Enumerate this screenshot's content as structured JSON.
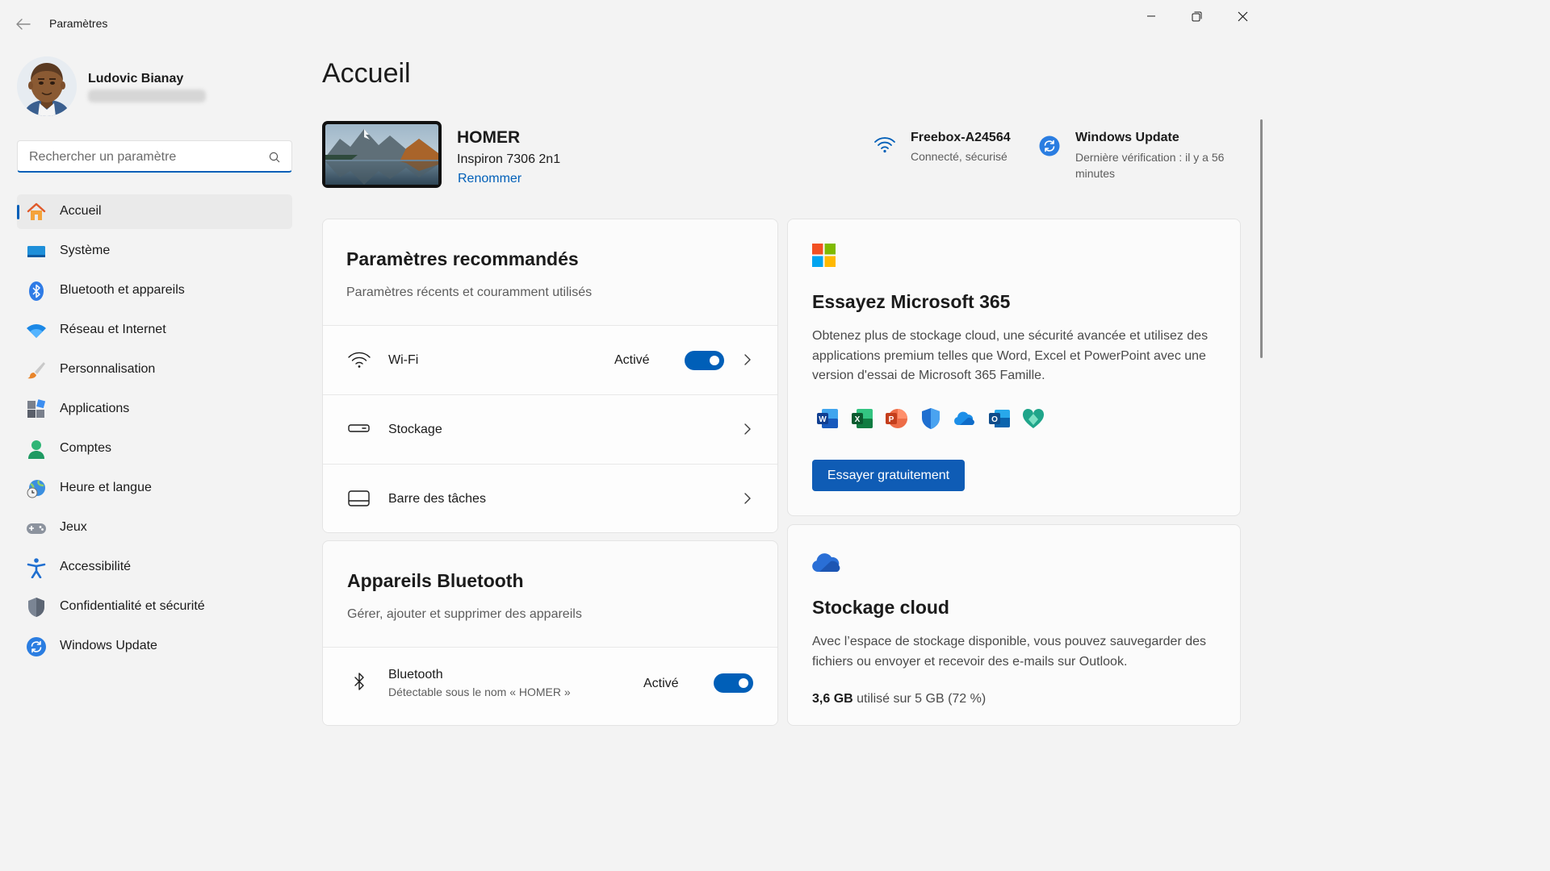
{
  "titlebar": {
    "title": "Paramètres"
  },
  "profile": {
    "name": "Ludovic Bianay"
  },
  "search": {
    "placeholder": "Rechercher un paramètre"
  },
  "sidebar": {
    "items": [
      {
        "label": "Accueil",
        "icon": "home-icon"
      },
      {
        "label": "Système",
        "icon": "system-icon"
      },
      {
        "label": "Bluetooth et appareils",
        "icon": "bluetooth-icon"
      },
      {
        "label": "Réseau et Internet",
        "icon": "network-icon"
      },
      {
        "label": "Personnalisation",
        "icon": "brush-icon"
      },
      {
        "label": "Applications",
        "icon": "apps-icon"
      },
      {
        "label": "Comptes",
        "icon": "accounts-icon"
      },
      {
        "label": "Heure et langue",
        "icon": "time-language-icon"
      },
      {
        "label": "Jeux",
        "icon": "gamepad-icon"
      },
      {
        "label": "Accessibilité",
        "icon": "accessibility-icon"
      },
      {
        "label": "Confidentialité et sécurité",
        "icon": "shield-icon"
      },
      {
        "label": "Windows Update",
        "icon": "update-icon"
      }
    ],
    "active_index": 0
  },
  "main": {
    "title": "Accueil",
    "device": {
      "name": "HOMER",
      "model": "Inspiron 7306 2n1",
      "rename_label": "Renommer"
    },
    "wifi": {
      "name": "Freebox-A24564",
      "status": "Connecté, sécurisé"
    },
    "update": {
      "title": "Windows Update",
      "status": "Dernière vérification : il y a 56 minutes"
    }
  },
  "recommended": {
    "title": "Paramètres recommandés",
    "subtitle": "Paramètres récents et couramment utilisés",
    "rows": [
      {
        "label": "Wi-Fi",
        "value": "Activé",
        "toggle_on": true,
        "icon": "wifi-icon"
      },
      {
        "label": "Stockage",
        "icon": "storage-icon"
      },
      {
        "label": "Barre des tâches",
        "icon": "taskbar-icon"
      }
    ]
  },
  "bluetooth_card": {
    "title": "Appareils Bluetooth",
    "subtitle": "Gérer, ajouter et supprimer des appareils",
    "row": {
      "label": "Bluetooth",
      "detail": "Détectable sous le nom « HOMER »",
      "value": "Activé",
      "toggle_on": true
    }
  },
  "m365": {
    "title": "Essayez Microsoft 365",
    "description": "Obtenez plus de stockage cloud, une sécurité avancée et utilisez des applications premium telles que Word, Excel et PowerPoint avec une version d'essai de Microsoft 365 Famille.",
    "button": "Essayer gratuitement",
    "apps": [
      "word-icon",
      "excel-icon",
      "powerpoint-icon",
      "defender-icon",
      "onedrive-icon",
      "outlook-icon",
      "family-safety-icon"
    ]
  },
  "cloud": {
    "title": "Stockage cloud",
    "description": "Avec l’espace de stockage disponible, vous pouvez sauvegarder des fichiers ou envoyer et recevoir des e-mails sur Outlook.",
    "used": "3,6 GB",
    "rest": "utilisé sur 5 GB (72 %)",
    "used_fraction": 0.72
  },
  "colors": {
    "accent": "#005fb8",
    "background": "#f3f3f3",
    "card": "#fbfbfb"
  }
}
